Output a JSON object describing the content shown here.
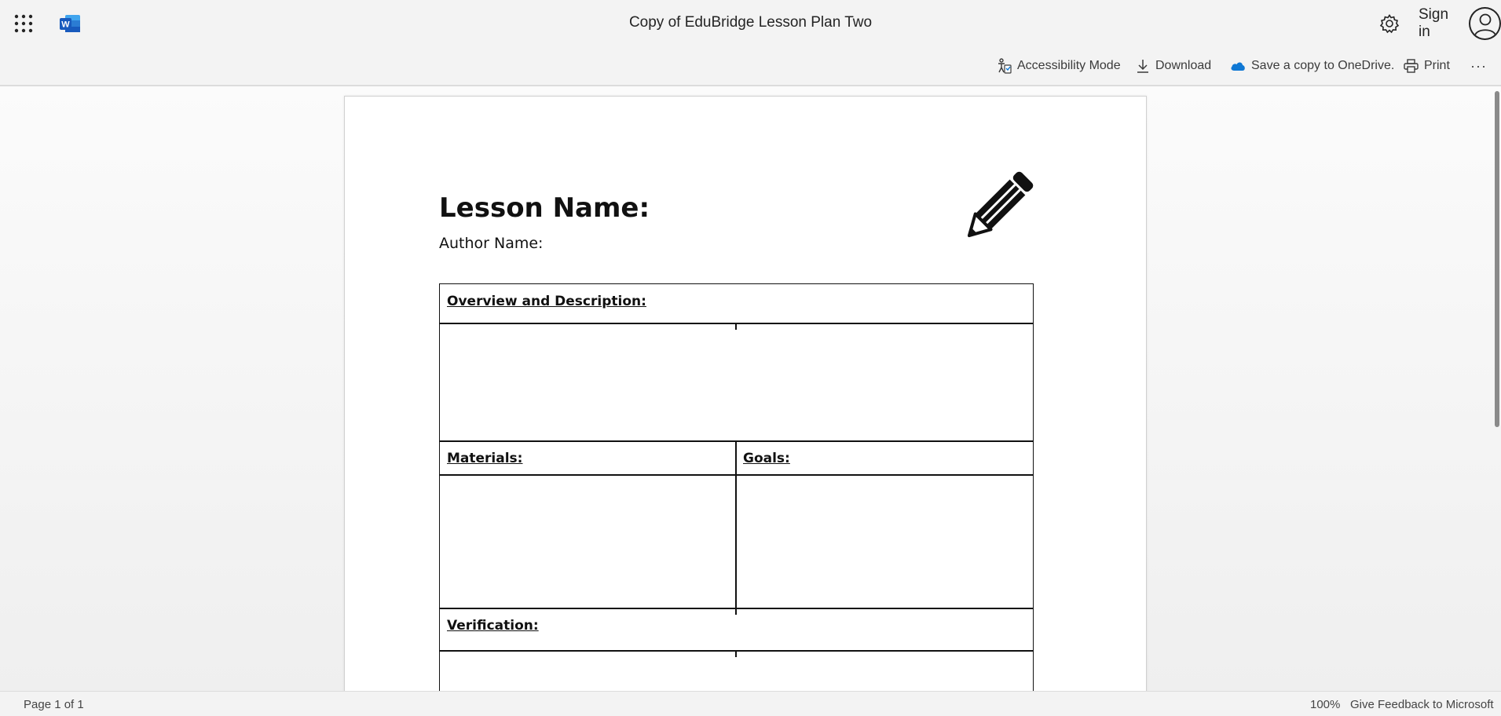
{
  "header": {
    "app_launcher_icon": "waffle-icon",
    "app_icon": "word-icon",
    "title": "Copy of EduBridge Lesson Plan Two",
    "settings_icon": "gear-icon",
    "signin_label": "Sign in",
    "avatar_icon": "person-icon"
  },
  "commands": {
    "accessibility": {
      "label": "Accessibility Mode",
      "icon": "accessibility-icon"
    },
    "download": {
      "label": "Download",
      "icon": "download-icon"
    },
    "save_copy": {
      "label": "Save a copy to OneDrive.",
      "icon": "onedrive-cloud-icon"
    },
    "print": {
      "label": "Print",
      "icon": "printer-icon"
    },
    "more": {
      "label": "···",
      "icon": "more-icon"
    }
  },
  "document": {
    "heading": "Lesson Name:",
    "author": "Author Name:",
    "image_icon": "pencil-icon",
    "table": {
      "overview": "Overview and Description:",
      "materials": "Materials:",
      "goals": "Goals:",
      "verification": "Verification:"
    }
  },
  "status": {
    "page_count": "Page 1 of 1",
    "zoom": "100%",
    "feedback": "Give Feedback to Microsoft"
  },
  "colors": {
    "word_brand": "#185abd",
    "onedrive_blue": "#0f78d4",
    "chrome_bg": "#f3f3f3",
    "text": "#242424"
  }
}
